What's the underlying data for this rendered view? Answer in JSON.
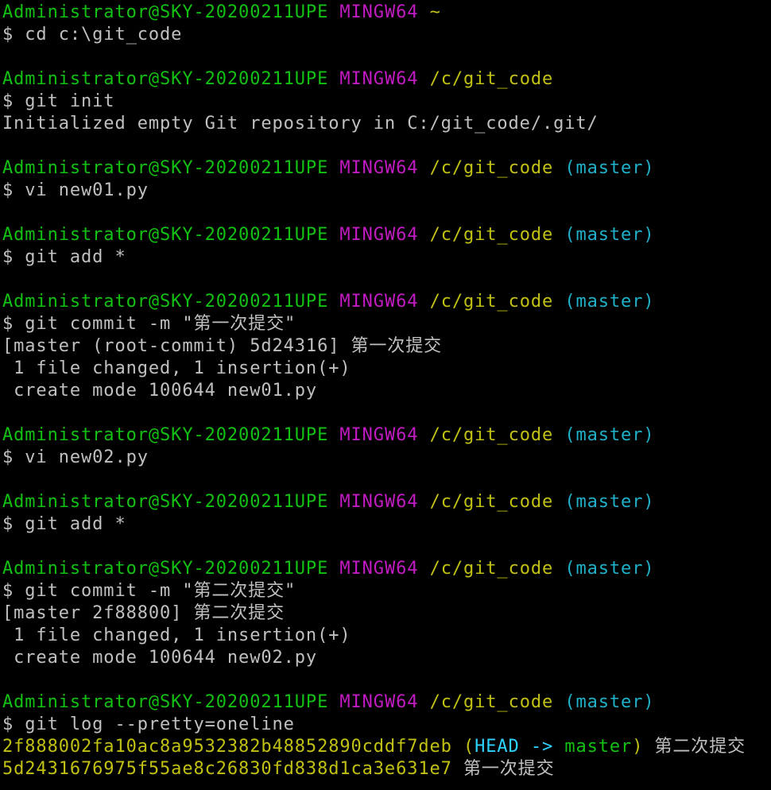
{
  "terminal": {
    "lines": [
      {
        "type": "prompt",
        "user": "Administrator@SKY-20200211UPE",
        "system": "MINGW64",
        "path": "~",
        "branch": ""
      },
      {
        "type": "command",
        "text": "$ cd c:\\git_code"
      },
      {
        "type": "blank"
      },
      {
        "type": "prompt",
        "user": "Administrator@SKY-20200211UPE",
        "system": "MINGW64",
        "path": "/c/git_code",
        "branch": ""
      },
      {
        "type": "command",
        "text": "$ git init"
      },
      {
        "type": "output",
        "text": "Initialized empty Git repository in C:/git_code/.git/"
      },
      {
        "type": "blank"
      },
      {
        "type": "prompt",
        "user": "Administrator@SKY-20200211UPE",
        "system": "MINGW64",
        "path": "/c/git_code",
        "branch": "(master)"
      },
      {
        "type": "command",
        "text": "$ vi new01.py"
      },
      {
        "type": "blank"
      },
      {
        "type": "prompt",
        "user": "Administrator@SKY-20200211UPE",
        "system": "MINGW64",
        "path": "/c/git_code",
        "branch": "(master)"
      },
      {
        "type": "command",
        "text": "$ git add *"
      },
      {
        "type": "blank"
      },
      {
        "type": "prompt",
        "user": "Administrator@SKY-20200211UPE",
        "system": "MINGW64",
        "path": "/c/git_code",
        "branch": "(master)"
      },
      {
        "type": "command",
        "text": "$ git commit -m \"第一次提交\""
      },
      {
        "type": "output",
        "text": "[master (root-commit) 5d24316] 第一次提交"
      },
      {
        "type": "output",
        "text": " 1 file changed, 1 insertion(+)"
      },
      {
        "type": "output",
        "text": " create mode 100644 new01.py"
      },
      {
        "type": "blank"
      },
      {
        "type": "prompt",
        "user": "Administrator@SKY-20200211UPE",
        "system": "MINGW64",
        "path": "/c/git_code",
        "branch": "(master)"
      },
      {
        "type": "command",
        "text": "$ vi new02.py"
      },
      {
        "type": "blank"
      },
      {
        "type": "prompt",
        "user": "Administrator@SKY-20200211UPE",
        "system": "MINGW64",
        "path": "/c/git_code",
        "branch": "(master)"
      },
      {
        "type": "command",
        "text": "$ git add *"
      },
      {
        "type": "blank"
      },
      {
        "type": "prompt",
        "user": "Administrator@SKY-20200211UPE",
        "system": "MINGW64",
        "path": "/c/git_code",
        "branch": "(master)"
      },
      {
        "type": "command",
        "text": "$ git commit -m \"第二次提交\""
      },
      {
        "type": "output",
        "text": "[master 2f88800] 第二次提交"
      },
      {
        "type": "output",
        "text": " 1 file changed, 1 insertion(+)"
      },
      {
        "type": "output",
        "text": " create mode 100644 new02.py"
      },
      {
        "type": "blank"
      },
      {
        "type": "prompt",
        "user": "Administrator@SKY-20200211UPE",
        "system": "MINGW64",
        "path": "/c/git_code",
        "branch": "(master)"
      },
      {
        "type": "command",
        "text": "$ git log --pretty=oneline"
      },
      {
        "type": "log",
        "hash": "2f888002fa10ac8a9532382b48852890cddf7deb",
        "ref_open": "(",
        "head": "HEAD",
        "arrow": " -> ",
        "branch": "master",
        "ref_close": ")",
        "message": "第二次提交"
      },
      {
        "type": "log",
        "hash": "5d2431676975f55ae8c26830fd838d1ca3e631e7",
        "message": "第一次提交"
      }
    ]
  },
  "colors": {
    "background": "#000000",
    "user": "#13c113",
    "system": "#c11bc1",
    "path": "#c1c113",
    "branch": "#1fb1c9",
    "text": "#c0c0c0",
    "head": "#2fd3ff"
  }
}
